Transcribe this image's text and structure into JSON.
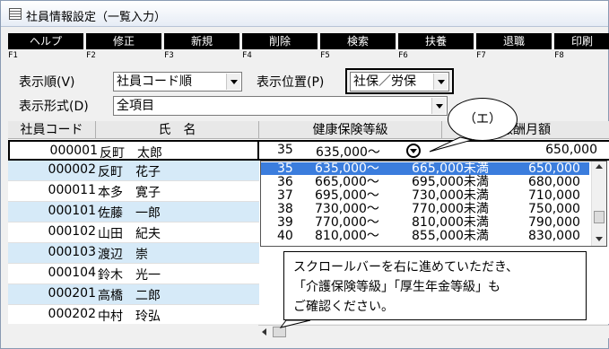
{
  "window": {
    "title": "社員情報設定（一覧入力）"
  },
  "function_keys": [
    {
      "label": "ヘルプ",
      "key": "F1"
    },
    {
      "label": "修正",
      "key": "F2"
    },
    {
      "label": "新規",
      "key": "F3"
    },
    {
      "label": "削除",
      "key": "F4"
    },
    {
      "label": "検索",
      "key": "F5"
    },
    {
      "label": "扶養",
      "key": "F6"
    },
    {
      "label": "退職",
      "key": "F7"
    },
    {
      "label": "印刷",
      "key": "F8"
    }
  ],
  "controls": {
    "sort_order_label": "表示順(V)",
    "sort_order_value": "社員コード順",
    "position_label": "表示位置(P)",
    "position_value": "社保／労保",
    "format_label": "表示形式(D)",
    "format_value": "全項目"
  },
  "grid": {
    "headers": {
      "code": "社員コード",
      "name": "氏　名",
      "grade": "健康保険等級",
      "monthly": "報酬月額"
    },
    "selected_row": {
      "grade_no": "35",
      "grade_value": "635,000～",
      "monthly": "650,000"
    },
    "rows": [
      {
        "code": "000001",
        "name": "反町　太郎"
      },
      {
        "code": "000002",
        "name": "反町　花子"
      },
      {
        "code": "000011",
        "name": "本多　寛子"
      },
      {
        "code": "000101",
        "name": "佐藤　一郎"
      },
      {
        "code": "000102",
        "name": "山田　紀夫"
      },
      {
        "code": "000103",
        "name": "渡辺　崇"
      },
      {
        "code": "000104",
        "name": "鈴木　光一"
      },
      {
        "code": "000201",
        "name": "高橋　二郎"
      },
      {
        "code": "000202",
        "name": "中村　玲弘"
      }
    ]
  },
  "dropdown": {
    "options": [
      {
        "no": "35",
        "from": "635,000～",
        "to": "665,000未満",
        "amount": "650,000"
      },
      {
        "no": "36",
        "from": "665,000～",
        "to": "695,000未満",
        "amount": "680,000"
      },
      {
        "no": "37",
        "from": "695,000～",
        "to": "730,000未満",
        "amount": "710,000"
      },
      {
        "no": "38",
        "from": "730,000～",
        "to": "770,000未満",
        "amount": "750,000"
      },
      {
        "no": "39",
        "from": "770,000～",
        "to": "810,000未満",
        "amount": "790,000"
      },
      {
        "no": "40",
        "from": "810,000～",
        "to": "855,000未満",
        "amount": "830,000"
      }
    ]
  },
  "annotations": {
    "bubble": "（エ）",
    "callout": [
      "スクロールバーを右に進めていただき、",
      "「介護保険等級」「厚生年金等級」も",
      "ご確認ください。"
    ]
  }
}
